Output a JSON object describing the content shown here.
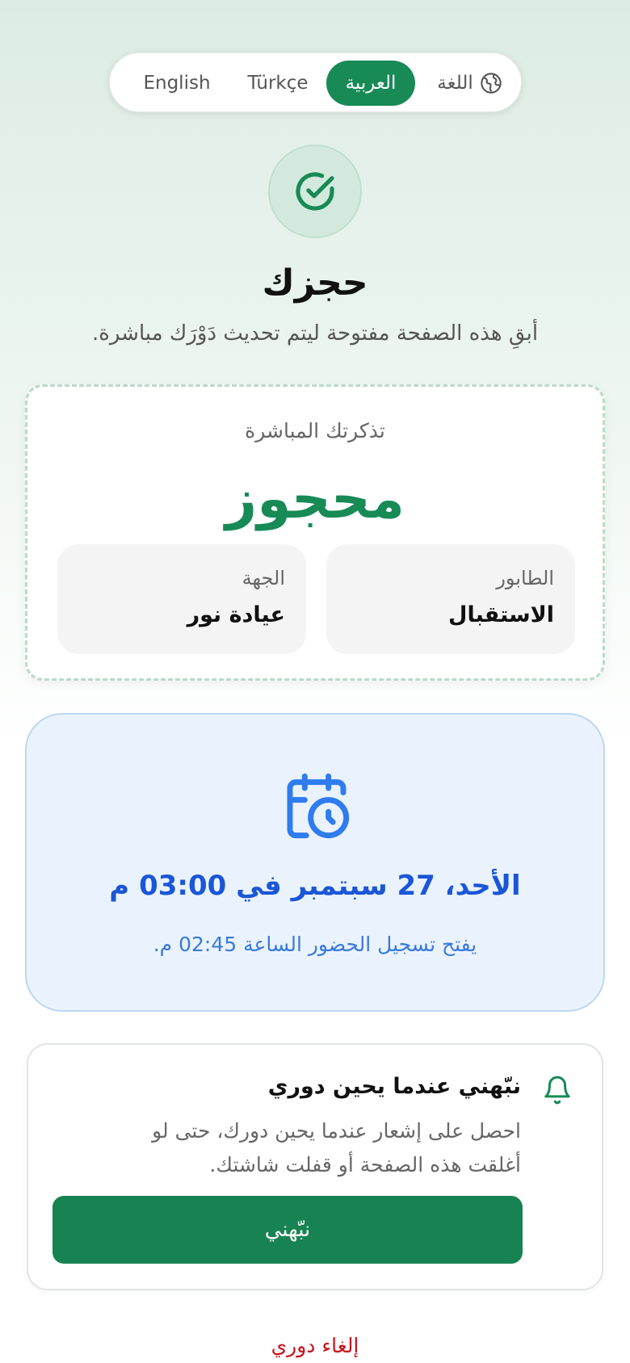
{
  "language_switcher": {
    "label": "اللغة",
    "options": [
      "English",
      "Türkçe",
      "العربية"
    ],
    "selected": "العربية"
  },
  "header": {
    "title": "حجزك",
    "subtitle": "أبقِ هذه الصفحة مفتوحة ليتم تحديث دَوْرَك مباشرة."
  },
  "ticket": {
    "label": "تذكرتك المباشرة",
    "status": "محجوز",
    "queue_label": "الطابور",
    "queue_value": "الاستقبال",
    "destination_label": "الجهة",
    "destination_value": "عيادة نور"
  },
  "appointment": {
    "datetime": "الأحد، 27 سبتمبر في 03:00 م",
    "checkin": "يفتح تسجيل الحضور الساعة 02:45 م."
  },
  "notify": {
    "title": "نبّهني عندما يحين دوري",
    "description": "احصل على إشعار عندما يحين دورك، حتى لو أغلقت هذه الصفحة أو قفلت شاشتك.",
    "button_label": "نبّهني"
  },
  "cancel_label": "إلغاء دوري",
  "colors": {
    "primary_green": "#178a56",
    "appointment_blue": "#1a56d8",
    "cancel_red": "#c8141c"
  }
}
